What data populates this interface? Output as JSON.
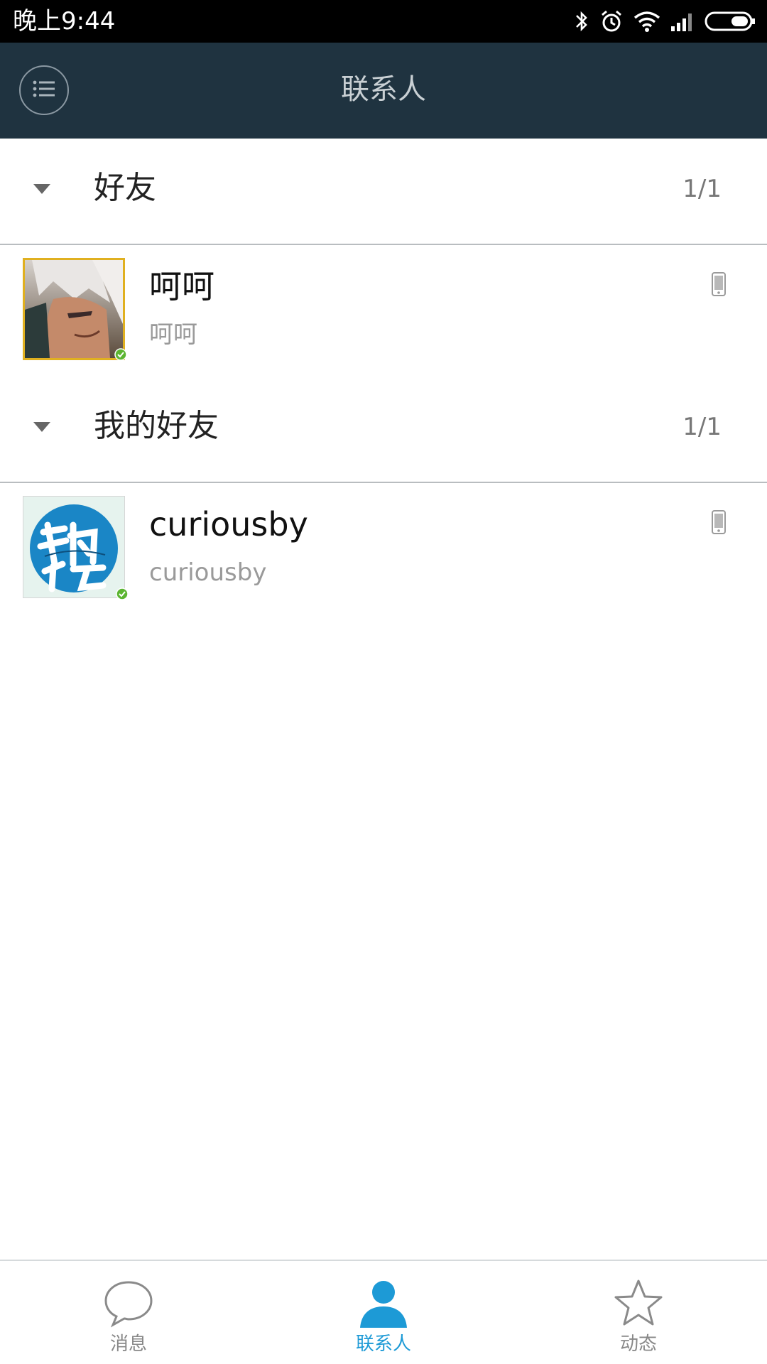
{
  "status_bar": {
    "time": "晚上9:44",
    "icons": [
      "bluetooth-icon",
      "alarm-icon",
      "wifi-icon",
      "signal-icon",
      "battery-icon"
    ]
  },
  "header": {
    "title": "联系人",
    "menu_icon": "list-menu-icon",
    "background": "#1f3340"
  },
  "groups": [
    {
      "name": "好友",
      "count": "1/1",
      "contacts": [
        {
          "name": "呵呵",
          "subtitle": "呵呵",
          "avatar": "anime-character-avatar",
          "status_icon": "online-check-icon",
          "device_icon": "phone-icon"
        }
      ]
    },
    {
      "name": "我的好友",
      "count": "1/1",
      "contacts": [
        {
          "name": "curiousby",
          "subtitle": "curiousby",
          "avatar": "blue-circle-text-avatar",
          "status_icon": "online-check-icon",
          "device_icon": "phone-icon"
        }
      ]
    }
  ],
  "bottom_nav": {
    "items": [
      {
        "label": "消息",
        "icon": "chat-bubble-icon",
        "active": false
      },
      {
        "label": "联系人",
        "icon": "person-icon",
        "active": true
      },
      {
        "label": "动态",
        "icon": "star-icon",
        "active": false
      }
    ],
    "active_color": "#1d9ad6"
  }
}
